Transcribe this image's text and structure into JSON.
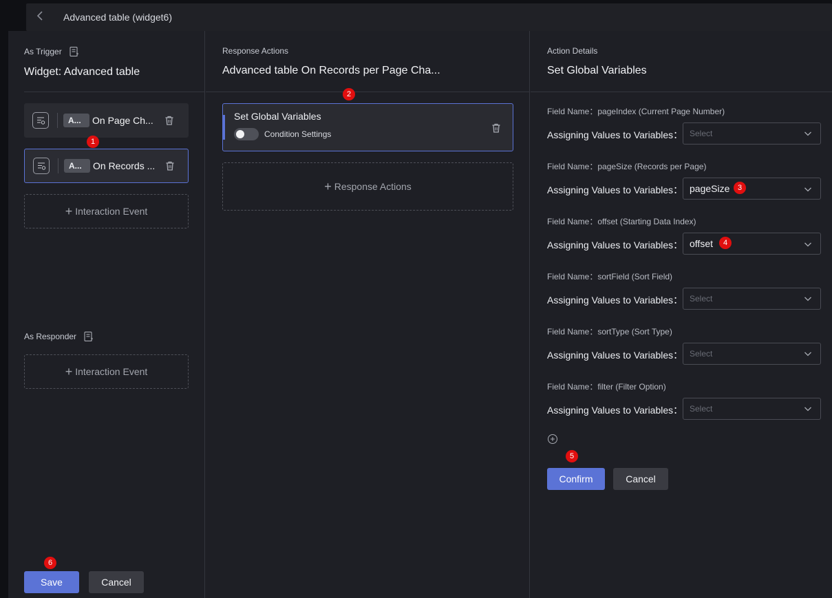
{
  "topbar": {
    "title": "Advanced table (widget6)"
  },
  "trigger": {
    "label": "As Trigger",
    "title": "Widget: Advanced table",
    "events": [
      {
        "tag": "A...",
        "name": "On Page Ch..."
      },
      {
        "tag": "A...",
        "name": "On Records ..."
      }
    ],
    "add_label": "Interaction Event"
  },
  "responder": {
    "label": "As Responder",
    "add_label": "Interaction Event"
  },
  "response": {
    "label": "Response Actions",
    "title": "Advanced table On Records per Page Cha...",
    "action": {
      "title": "Set Global Variables",
      "condition_label": "Condition Settings",
      "condition_enabled": false
    },
    "add_label": "Response Actions"
  },
  "details": {
    "label": "Action Details",
    "title": "Set Global Variables",
    "fields": [
      {
        "field": "Field Name：pageIndex (Current Page Number)",
        "assign": "Assigning Values to Variables：",
        "value": "Select"
      },
      {
        "field": "Field Name：pageSize (Records per Page)",
        "assign": "Assigning Values to Variables：",
        "value": "pageSize"
      },
      {
        "field": "Field Name：offset (Starting Data Index)",
        "assign": "Assigning Values to Variables：",
        "value": "offset"
      },
      {
        "field": "Field Name：sortField (Sort Field)",
        "assign": "Assigning Values to Variables：",
        "value": "Select"
      },
      {
        "field": "Field Name：sortType (Sort Type)",
        "assign": "Assigning Values to Variables：",
        "value": "Select"
      },
      {
        "field": "Field Name：filter (Filter Option)",
        "assign": "Assigning Values to Variables：",
        "value": "Select"
      }
    ],
    "confirm_label": "Confirm",
    "cancel_label": "Cancel"
  },
  "footer": {
    "save_label": "Save",
    "cancel_label": "Cancel"
  },
  "badges": [
    "1",
    "2",
    "3",
    "4",
    "5",
    "6"
  ],
  "colors": {
    "accent": "#5b73d6",
    "badge": "#e10f0f",
    "panel": "#1e1f25"
  }
}
